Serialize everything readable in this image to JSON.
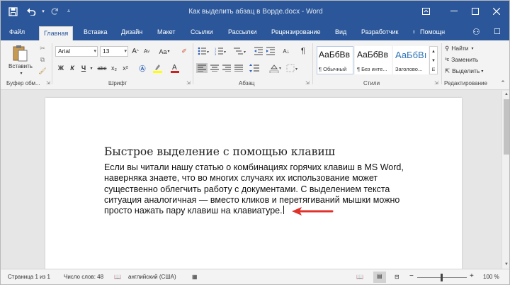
{
  "titlebar": {
    "document_title": "Как выделить абзац в Ворде.docx - Word",
    "save_icon": "save-icon",
    "undo_icon": "undo-icon",
    "redo_icon": "redo-icon",
    "customize_icon": "customize-qat-icon",
    "color": "#2b579a"
  },
  "tabs": [
    "Файл",
    "Главная",
    "Вставка",
    "Дизайн",
    "Макет",
    "Ссылки",
    "Рассылки",
    "Рецензирование",
    "Вид",
    "Разработчик",
    "Помощн"
  ],
  "active_tab": "Главная",
  "ribbon": {
    "clipboard": {
      "paste_label": "Вставить",
      "group_label": "Буфер обм..."
    },
    "font": {
      "font_name": "Arial",
      "font_size": "13",
      "group_label": "Шрифт",
      "bold": "Ж",
      "italic": "К",
      "underline": "Ч",
      "strike": "abc",
      "subscript": "x₂",
      "superscript": "x²",
      "grow": "A",
      "shrink": "A",
      "case": "Aa"
    },
    "paragraph": {
      "group_label": "Абзац",
      "pilcrow": "¶"
    },
    "styles": {
      "group_label": "Стили",
      "items": [
        {
          "preview": "АаБбВв",
          "name": "¶ Обычный"
        },
        {
          "preview": "АаБбВв",
          "name": "¶ Без инте..."
        },
        {
          "preview": "АаБбВı",
          "name": "Заголово..."
        }
      ]
    },
    "editing": {
      "group_label": "Редактирование",
      "find": "Найти",
      "replace": "Заменить",
      "select": "Выделить"
    }
  },
  "document": {
    "heading": "Быстрое выделение с помощью клавиш",
    "paragraph_lines": [
      "Если вы читали нашу статью о комбинациях горячих клавиш в MS Word,",
      "наверняка знаете, что во многих случаях их использование может",
      "существенно облегчить работу с документами. С выделением текста",
      "ситуация аналогичная — вместо кликов и перетягиваний мышки можно",
      "просто нажать пару клавиш на клавиатуре."
    ],
    "arrow_color": "#e0312b"
  },
  "statusbar": {
    "page": "Страница 1 из 1",
    "words": "Число слов: 48",
    "language": "английский (США)",
    "zoom": "100 %",
    "zoom_minus": "−",
    "zoom_plus": "+"
  }
}
